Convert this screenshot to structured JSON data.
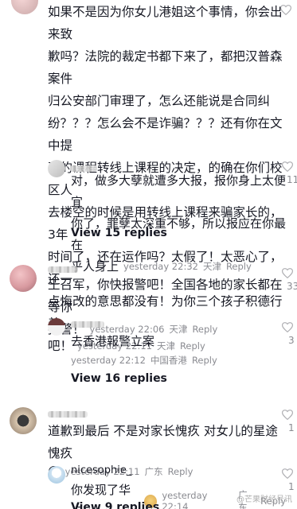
{
  "comment1": {
    "text_lines": [
      "如果不是因为你女儿港姐这个事情，你会出来致",
      "歉吗？法院的裁定书都下来了，都把汉普森案件",
      "归公安部门审理了，怎么还能说是合同纠",
      "纷？？？怎么会不是诈骗？？？还有你在文中提",
      "到的课程转线上课程的决定，的确在你们校区人",
      "去楼空的时候是用转线上课程来骗家长的，3年",
      "时间了，还在运作吗？太假了！太恶心了，还一",
      "点悔改的意思都没有！为你三个孩子积德行善",
      "吧！"
    ],
    "time": "yesterday 22:11",
    "location": "天津",
    "reply": "Reply"
  },
  "reply1": {
    "text_lines": [
      "对，做多大孽就遭多大报，报你身上太便宜",
      "你了，罪孽太深重不够，所以报应在你最在",
      "乎人身上"
    ],
    "time": "yesterday 22:32",
    "location": "天津",
    "reply": "Reply",
    "like_count": "11"
  },
  "view1": "View 15 replies",
  "comment2": {
    "text_lines": [
      "王召军，你快报警吧！全国各地的家长都在等你",
      "报警！"
    ],
    "time": "yesterday 22:06",
    "location": "天津",
    "reply": "Reply",
    "like_count": "33"
  },
  "reply2": {
    "text_lines": [
      "去香港報警立案"
    ],
    "time": "yesterday 22:12",
    "location": "中国香港",
    "reply": "Reply",
    "like_count": "3"
  },
  "view2": "View 16 replies",
  "comment3": {
    "text_lines": [
      "道歉到最后 不是对家长愧疚 对女儿的星途愧疚"
    ],
    "emoji": "😅",
    "time": "yesterday 22:11",
    "location": "广东",
    "reply": "Reply",
    "like_count": "1"
  },
  "reply3": {
    "username": "nicesophie_",
    "text": "你发现了华点",
    "time": "yesterday 22:14",
    "location": "广东",
    "reply": "Reply",
    "like_count": "1"
  },
  "view3": "View 9 replies",
  "watermark": "@芒果财经号讯",
  "colors": {
    "text": "#161823",
    "meta": "#8a8b91",
    "heart": "#b0b0b4"
  }
}
